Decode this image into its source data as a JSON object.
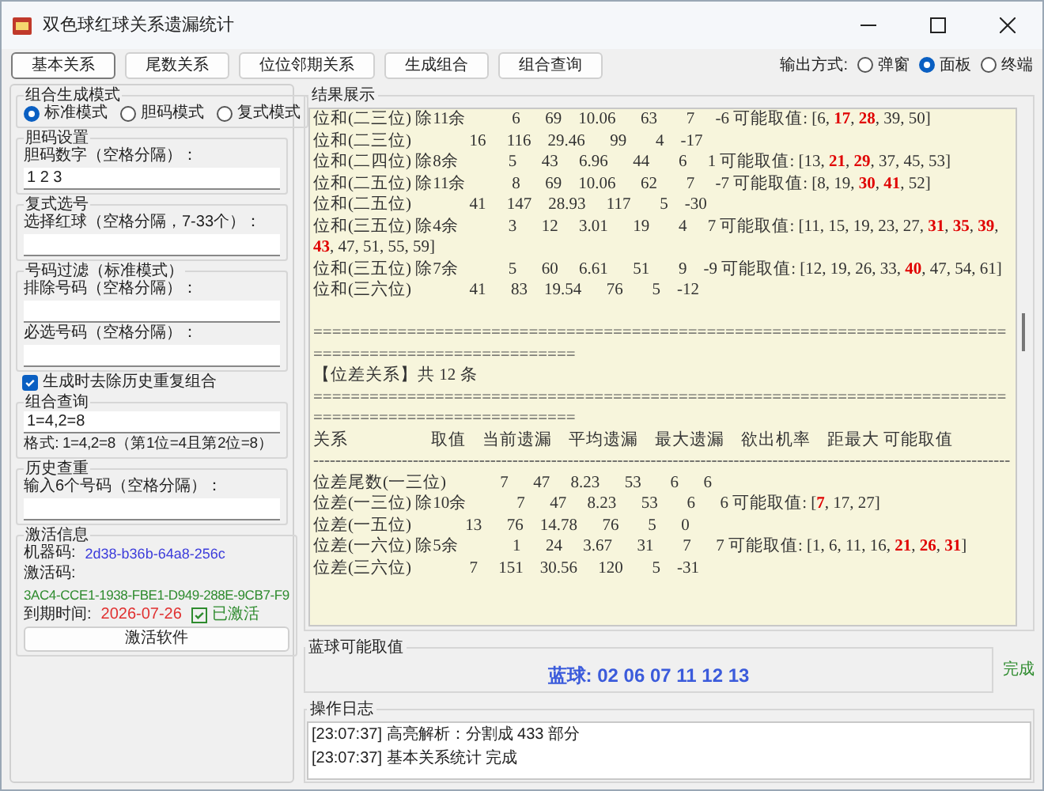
{
  "window": {
    "title": "双色球红球关系遗漏统计"
  },
  "tabs": [
    {
      "label": "基本关系",
      "selected": true
    },
    {
      "label": "尾数关系",
      "selected": false
    },
    {
      "label": "位位邻期关系",
      "selected": false
    },
    {
      "label": "生成组合",
      "selected": false
    },
    {
      "label": "组合查询",
      "selected": false
    }
  ],
  "output_mode": {
    "label": "输出方式:",
    "options": [
      {
        "label": "弹窗",
        "selected": false
      },
      {
        "label": "面板",
        "selected": true
      },
      {
        "label": "终端",
        "selected": false
      }
    ]
  },
  "left_panel": {
    "generation_mode": {
      "title": "组合生成模式",
      "options": [
        {
          "label": "标准模式",
          "selected": true
        },
        {
          "label": "胆码模式",
          "selected": false
        },
        {
          "label": "复式模式",
          "selected": false
        }
      ]
    },
    "banker": {
      "title": "胆码设置",
      "field_label": "胆码数字（空格分隔）：",
      "value": "1 2 3"
    },
    "compound": {
      "title": "复式选号",
      "field_label": "选择红球（空格分隔，7-33个）："
    },
    "filter": {
      "title": "号码过滤（标准模式）",
      "fields": [
        {
          "label": "排除号码（空格分隔）："
        },
        {
          "label": "必选号码（空格分隔）："
        }
      ]
    },
    "dedupe": {
      "label": "生成时去除历史重复组合",
      "checked": true
    },
    "query": {
      "title": "组合查询",
      "value": "1=4,2=8",
      "hint": "格式: 1=4,2=8（第1位=4且第2位=8）"
    },
    "history": {
      "title": "历史查重",
      "field_label": "输入6个号码（空格分隔）："
    },
    "activation": {
      "title": "激活信息",
      "machine_label": "机器码:",
      "machine_code": "2d38-b36b-64a8-256c",
      "code_label": "激活码:",
      "code": "3AC4-CCE1-1938-FBE1-D949-288E-9CB7-F9",
      "expiry_label": "到期时间:",
      "expiry": "2026-07-26",
      "activated": {
        "label": "已激活",
        "checked": true
      },
      "button": "激活软件"
    }
  },
  "results": {
    "title": "结果展示",
    "lines": [
      {
        "kind": "text",
        "text": "位和(二三位) 除11余           6      69    10.06      63       7     -6 可能取值: [6, **17**, **28**, 39, 50]"
      },
      {
        "kind": "text",
        "text": "位和(二三位)              16     116    29.46      99       4    -17"
      },
      {
        "kind": "text",
        "text": "位和(二四位) 除8余            5      43     6.96      44       6     1 可能取值: [13, **21**, **29**, 37, 45, 53]"
      },
      {
        "kind": "text",
        "text": "位和(二五位) 除11余           8      69    10.06      62       7     -7 可能取值: [8, 19, **30**, **41**, 52]"
      },
      {
        "kind": "text",
        "text": "位和(二五位)              41     147    28.93     117       5    -30"
      },
      {
        "kind": "text",
        "text": "位和(三五位) 除4余            3      12     3.01      19       4     7 可能取值: [11, 15, 19, 23, 27, **31**, **35**, **39**, **43**, 47, 51, 55, 59]"
      },
      {
        "kind": "text",
        "text": "位和(三五位) 除7余            5      60     6.61      51       9    -9 可能取值: [12, 19, 26, 33, **40**, 47, 54, 61]"
      },
      {
        "kind": "text",
        "text": "位和(三六位)              41      83    19.54      76       5    -12"
      },
      {
        "kind": "gap"
      },
      {
        "kind": "rule",
        "text": "======================================================================================================"
      },
      {
        "kind": "text",
        "text": "【位差关系】共 12 条"
      },
      {
        "kind": "rule",
        "text": "======================================================================================================"
      },
      {
        "kind": "text",
        "text": "关系                    取值    当前遗漏    平均遗漏    最大遗漏    欲出机率    距最大 可能取值"
      },
      {
        "kind": "rule",
        "text": "------------------------------------------------------------------------------------------------------------------------------"
      },
      {
        "kind": "text",
        "text": "位差尾数(一三位)             7      47     8.23      53       6      6"
      },
      {
        "kind": "text",
        "text": "位差(一三位) 除10余            7      47     8.23      53       6      6 可能取值: [**7**, 17, 27]"
      },
      {
        "kind": "text",
        "text": "位差(一五位)             13      76    14.78      76       5      0"
      },
      {
        "kind": "text",
        "text": "位差(一六位) 除5余             1      24     3.67      31       7      7 可能取值: [1, 6, 11, 16, **21**, **26**, **31**]"
      },
      {
        "kind": "text",
        "text": "位差(三六位)              7     151    30.56     120       5    -31"
      }
    ]
  },
  "blue_ball": {
    "title": "蓝球可能取值",
    "value": "蓝球: 02 06 07 11 12 13"
  },
  "status": "完成",
  "log": {
    "title": "操作日志",
    "entries": [
      "[23:07:37] 高亮解析：分割成 433 部分",
      "[23:07:37] 基本关系统计 完成"
    ]
  }
}
